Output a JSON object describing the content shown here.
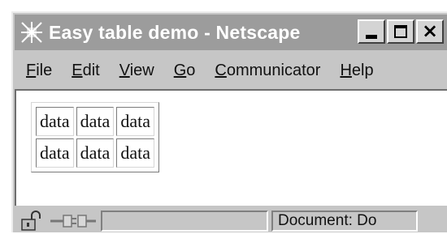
{
  "window": {
    "title": "Easy table demo - Netscape"
  },
  "menu": [
    {
      "accel": "F",
      "rest": "ile"
    },
    {
      "accel": "E",
      "rest": "dit"
    },
    {
      "accel": "V",
      "rest": "iew"
    },
    {
      "accel": "G",
      "rest": "o"
    },
    {
      "accel": "C",
      "rest": "ommunicator"
    },
    {
      "accel": "H",
      "rest": "elp"
    }
  ],
  "table": {
    "rows": [
      [
        "data",
        "data",
        "data"
      ],
      [
        "data",
        "data",
        "data"
      ]
    ]
  },
  "status": {
    "document_text": "Document: Do"
  },
  "icons": {
    "app": "netscape-logo-icon",
    "lock": "security-lock-icon",
    "plug": "connection-plug-icon"
  },
  "colors": {
    "titlebar": "#9c9c9c",
    "chrome": "#c6c6c6"
  }
}
